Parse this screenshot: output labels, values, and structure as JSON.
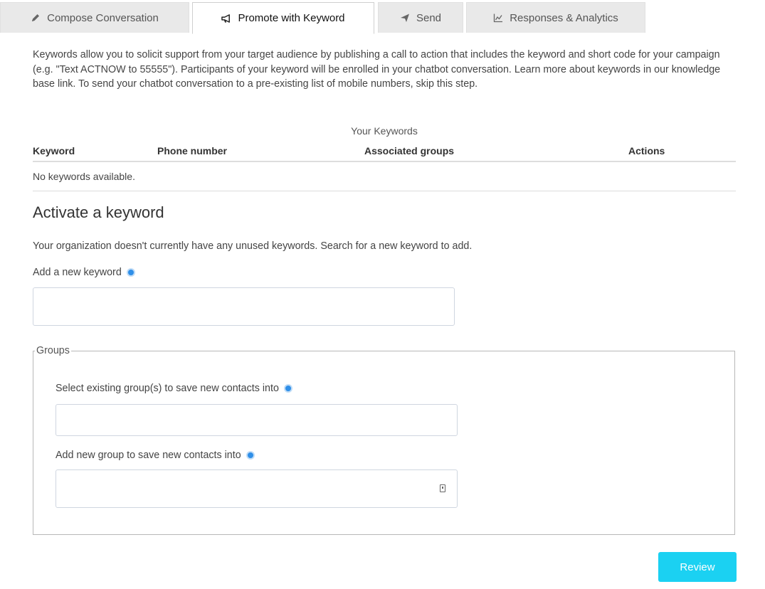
{
  "tabs": [
    {
      "label": "Compose Conversation",
      "icon": "pencil-icon",
      "active": false
    },
    {
      "label": "Promote with Keyword",
      "icon": "megaphone-icon",
      "active": true
    },
    {
      "label": "Send",
      "icon": "paper-plane-icon",
      "active": false
    },
    {
      "label": "Responses & Analytics",
      "icon": "line-chart-icon",
      "active": false
    }
  ],
  "intro_text": "Keywords allow you to solicit support from your target audience by publishing a call to action that includes the keyword and short code for your campaign (e.g. \"Text ACTNOW to 55555\"). Participants of your keyword will be enrolled in your chatbot conversation. Learn more about keywords in our knowledge base link. To send your chatbot conversation to a pre-existing list of mobile numbers, skip this step.",
  "keywords_table": {
    "caption": "Your Keywords",
    "columns": [
      "Keyword",
      "Phone number",
      "Associated groups",
      "Actions"
    ],
    "empty_message": "No keywords available."
  },
  "activate": {
    "heading": "Activate a keyword",
    "note": "Your organization doesn't currently have any unused keywords. Search for a new keyword to add.",
    "add_keyword_label": "Add a new keyword",
    "add_keyword_value": ""
  },
  "groups": {
    "legend": "Groups",
    "existing_label": "Select existing group(s) to save new contacts into",
    "existing_value": "",
    "new_label": "Add new group to save new contacts into",
    "new_value": ""
  },
  "review_button": "Review",
  "colors": {
    "accent": "#1bd1f2",
    "info_dot": "#2f8fe8",
    "tab_inactive_bg": "#e9e9e9"
  }
}
